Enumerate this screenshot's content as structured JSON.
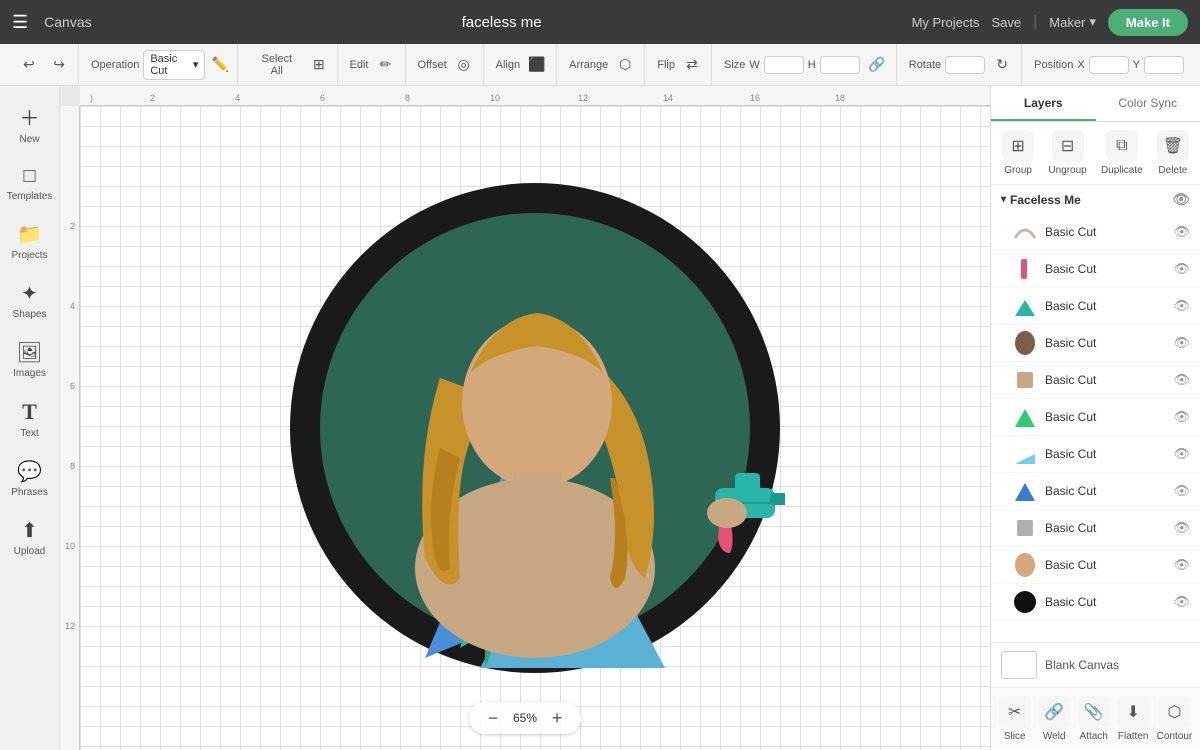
{
  "topbar": {
    "menu_icon": "☰",
    "canvas_label": "Canvas",
    "title": "faceless me",
    "my_projects": "My Projects",
    "save": "Save",
    "divider": "|",
    "maker_label": "Maker",
    "make_it": "Make It"
  },
  "toolbar": {
    "undo_icon": "↩",
    "redo_icon": "↪",
    "operation_label": "Operation",
    "operation_value": "Basic Cut",
    "edit_icon": "✏️",
    "select_all_label": "Select All",
    "edit_label": "Edit",
    "offset_label": "Offset",
    "align_label": "Align",
    "arrange_label": "Arrange",
    "flip_label": "Flip",
    "size_label": "Size",
    "w_label": "W",
    "h_label": "H",
    "rotate_label": "Rotate",
    "position_label": "Position",
    "x_label": "X",
    "y_label": "Y"
  },
  "sidebar": {
    "items": [
      {
        "icon": "＋",
        "label": "New"
      },
      {
        "icon": "□",
        "label": "Templates"
      },
      {
        "icon": "📁",
        "label": "Projects"
      },
      {
        "icon": "✦",
        "label": "Shapes"
      },
      {
        "icon": "🖼",
        "label": "Images"
      },
      {
        "icon": "T",
        "label": "Text"
      },
      {
        "icon": "💬",
        "label": "Phrases"
      },
      {
        "icon": "⬆",
        "label": "Upload"
      }
    ]
  },
  "canvas": {
    "zoom_level": "65%",
    "ruler_ticks_h": [
      ")",
      "2",
      "4",
      "6",
      "8",
      "10",
      "12",
      "14",
      "16",
      "18"
    ],
    "ruler_ticks_v": [
      "",
      "2",
      "4",
      "6",
      "8",
      "10",
      "12"
    ]
  },
  "right_panel": {
    "tabs": [
      {
        "label": "Layers",
        "active": true
      },
      {
        "label": "Color Sync",
        "active": false
      }
    ],
    "actions": [
      {
        "icon": "⊞",
        "label": "Group"
      },
      {
        "icon": "⊟",
        "label": "Ungroup"
      },
      {
        "icon": "⧉",
        "label": "Duplicate"
      },
      {
        "icon": "🗑",
        "label": "Delete"
      }
    ],
    "layer_group": {
      "name": "Faceless Me",
      "expanded": true
    },
    "layers": [
      {
        "color": "#c8b8a8",
        "label": "Basic Cut",
        "shape": "arc"
      },
      {
        "color": "#e05080",
        "label": "Basic Cut",
        "shape": "stripe"
      },
      {
        "color": "#29b5a8",
        "label": "Basic Cut",
        "shape": "teal-shape"
      },
      {
        "color": "#6d4c3d",
        "label": "Basic Cut",
        "shape": "head"
      },
      {
        "color": "#c8a882",
        "label": "Basic Cut",
        "shape": "face"
      },
      {
        "color": "#2ecc71",
        "label": "Basic Cut",
        "shape": "green-shape"
      },
      {
        "color": "#5bc8dc",
        "label": "Basic Cut",
        "shape": "light-blue"
      },
      {
        "color": "#3a7bd5",
        "label": "Basic Cut",
        "shape": "blue-shape"
      },
      {
        "color": "#b0b0b0",
        "label": "Basic Cut",
        "shape": "gray-shape"
      },
      {
        "color": "#d4a87a",
        "label": "Basic Cut",
        "shape": "skin"
      },
      {
        "color": "#111111",
        "label": "Basic Cut",
        "shape": "circle"
      }
    ],
    "blank_canvas": {
      "label": "Blank Canvas"
    },
    "bottom_actions": [
      {
        "icon": "✂",
        "label": "Slice"
      },
      {
        "icon": "🔗",
        "label": "Weld"
      },
      {
        "icon": "📎",
        "label": "Attach"
      },
      {
        "icon": "⬇",
        "label": "Flatten"
      },
      {
        "icon": "⬡",
        "label": "Contour"
      }
    ]
  }
}
